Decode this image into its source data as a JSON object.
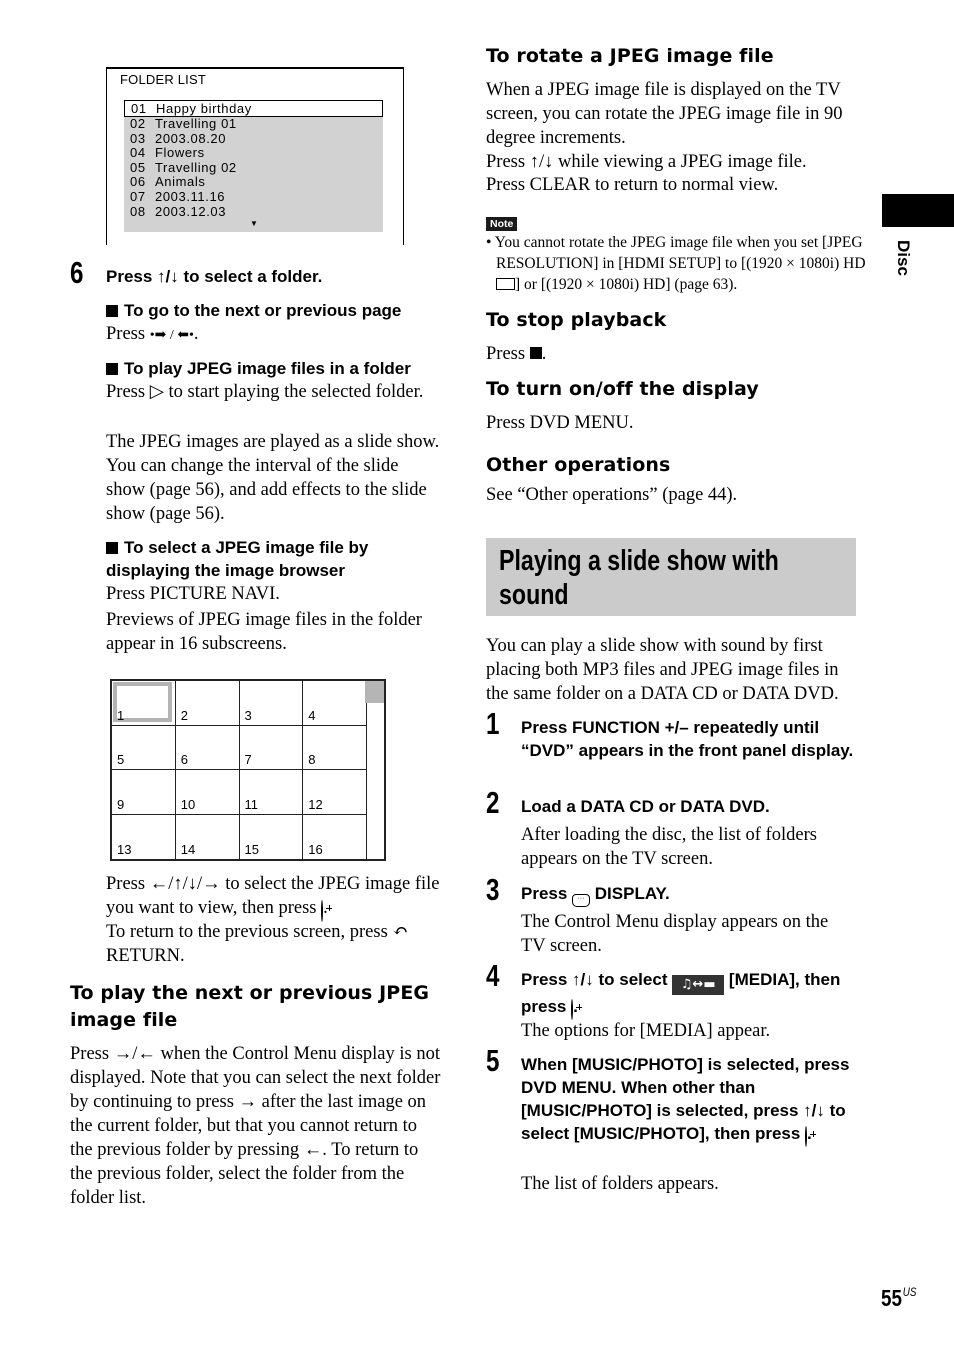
{
  "side_tab": {
    "label": "Disc"
  },
  "page_number": {
    "num": "55",
    "suffix": "US"
  },
  "folder_list": {
    "title": "FOLDER LIST",
    "items": [
      {
        "num": "01",
        "name": "Happy birthday",
        "selected": true
      },
      {
        "num": "02",
        "name": "Travelling 01"
      },
      {
        "num": "03",
        "name": "2003.08.20"
      },
      {
        "num": "04",
        "name": "Flowers"
      },
      {
        "num": "05",
        "name": "Travelling 02"
      },
      {
        "num": "06",
        "name": "Animals"
      },
      {
        "num": "07",
        "name": "2003.11.16"
      },
      {
        "num": "08",
        "name": "2003.12.03"
      }
    ],
    "scroll_icon": "▼"
  },
  "left": {
    "step6": {
      "num": "6",
      "title_pre": "Press ",
      "title_arrows": "↑/↓",
      "title_post": " to select a folder."
    },
    "next_page": {
      "heading": "To go to the next or previous page",
      "text_pre": "Press ",
      "icons": "•➡ / ⬅•",
      "text_post": "."
    },
    "play_folder": {
      "heading": "To play JPEG image files in a folder",
      "text1_pre": "Press ",
      "play_icon": "▷",
      "text1_post": " to start playing the selected folder.",
      "text2": "The JPEG images are played as a slide show. You can change the interval of the slide show (page 56), and add effects to the slide show (page 56)."
    },
    "browser": {
      "heading_line1": "To select a JPEG image file by",
      "heading_line2": "displaying the image browser",
      "text1": "Press PICTURE NAVI.",
      "text2": "Previews of JPEG image files in the folder appear in 16 subscreens.",
      "cells": [
        "1",
        "2",
        "3",
        "4",
        "5",
        "6",
        "7",
        "8",
        "9",
        "10",
        "11",
        "12",
        "13",
        "14",
        "15",
        "16"
      ],
      "after_pre": "Press ",
      "after_arrows": "←/↑/↓/→",
      "after_mid": " to select the JPEG image file you want to view, then press ",
      "after_post": ".",
      "return_pre": "To return to the previous screen, press ",
      "return_icon": "↶",
      "return_post": " RETURN."
    },
    "next_prev_jpeg": {
      "heading": "To play the next or previous JPEG image file",
      "p_pre": "Press ",
      "p_arrows": "→/←",
      "p_1": " when the Control Menu display is not displayed. Note that you can select the next folder by continuing to press ",
      "p_arrow_right": "→",
      "p_2": " after the last image on the current folder, but that you cannot return to the previous folder by pressing ",
      "p_arrow_left": "←",
      "p_3": ". To return to the previous folder, select the folder from the folder list."
    }
  },
  "right": {
    "rotate": {
      "heading": "To rotate a JPEG image file",
      "text1": "When a JPEG image file is displayed on the TV screen, you can rotate the JPEG image file in 90 degree increments.",
      "text2_pre": "Press ",
      "text2_arrows": "↑/↓",
      "text2_post": " while viewing a JPEG image file.",
      "text3": "Press CLEAR to return to normal view."
    },
    "note": {
      "badge": "Note",
      "text_pre": "You cannot rotate the JPEG image file when you set [JPEG RESOLUTION] in [HDMI SETUP] to [(1920 × 1080i) HD ",
      "text_post": "] or [(1920 × 1080i) HD] (page 63)."
    },
    "stop": {
      "heading": "To stop playback",
      "text_pre": "Press ",
      "text_post": "."
    },
    "display": {
      "heading": "To turn on/off the display",
      "text": "Press DVD MENU."
    },
    "other": {
      "heading": "Other operations",
      "text": "See “Other operations” (page 44)."
    },
    "slideshow": {
      "heading": "Playing a slide show with sound",
      "intro": "You can play a slide show with sound by first placing both MP3 files and JPEG image files in the same folder on a DATA CD or DATA DVD.",
      "steps": [
        {
          "num": "1",
          "title": "Press FUNCTION +/– repeatedly until “DVD” appears in the front panel display."
        },
        {
          "num": "2",
          "title": "Load a DATA CD or DATA DVD.",
          "body": "After loading the disc, the list of folders appears on the TV screen."
        },
        {
          "num": "3",
          "title_pre": "Press ",
          "title_post": " DISPLAY.",
          "body": "The Control Menu display appears on the TV screen."
        },
        {
          "num": "4",
          "title_pre": "Press ",
          "title_arrows": "↑/↓",
          "title_mid": " to select ",
          "media_icon": "♫↔▬",
          "title_mid2": " [MEDIA], then press ",
          "title_post": ".",
          "body": "The options for [MEDIA] appear."
        },
        {
          "num": "5",
          "title_pre": "When [MUSIC/PHOTO] is selected, press DVD MENU. When other than [MUSIC/PHOTO] is selected, press ",
          "title_arrows": "↑/↓",
          "title_mid": " to select [MUSIC/PHOTO], then press ",
          "title_post": ".",
          "body": "The list of folders appears."
        }
      ]
    }
  }
}
